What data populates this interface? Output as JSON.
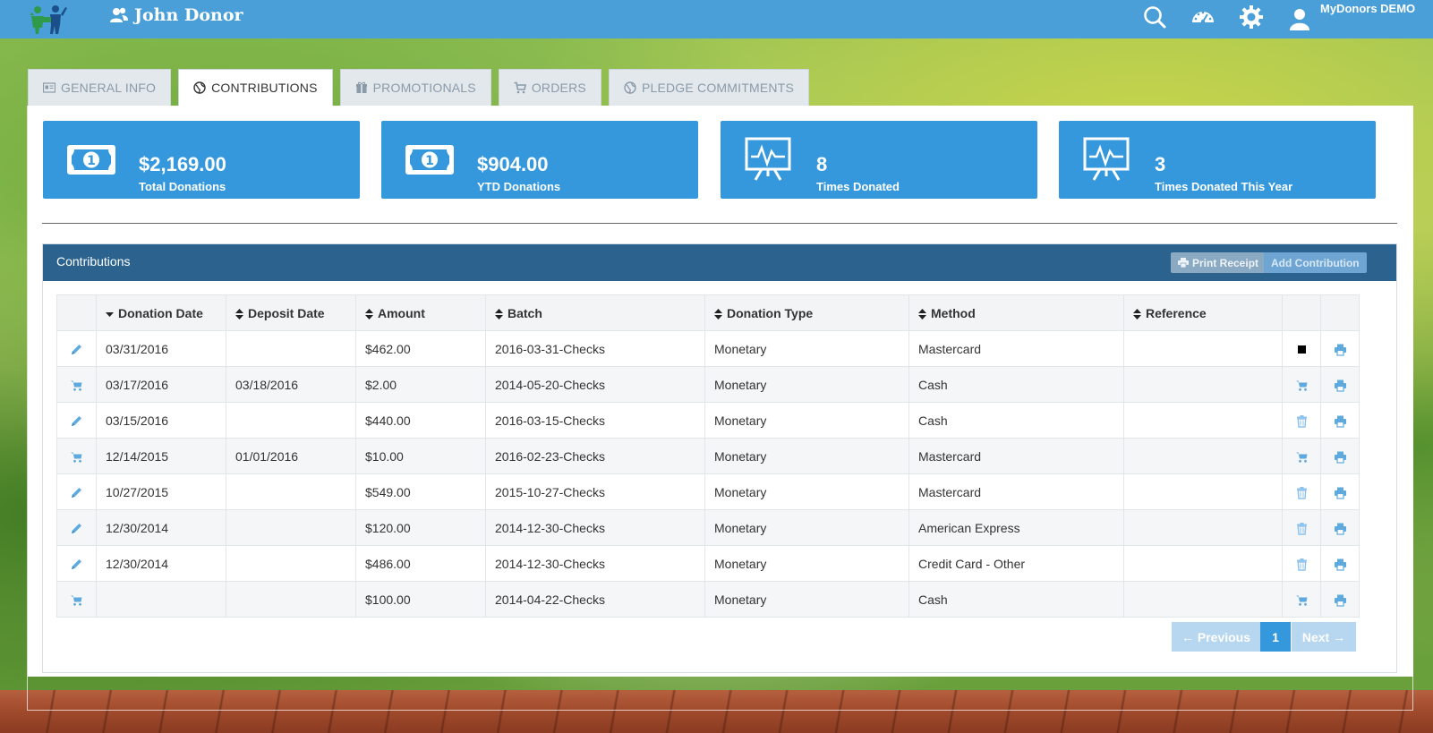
{
  "header": {
    "donor_name": "John Donor",
    "app_name": "MyDonors DEMO",
    "icons": [
      "search-icon",
      "dashboard-icon",
      "gear-icon",
      "user-icon"
    ]
  },
  "tabs": [
    {
      "label": "GENERAL INFO",
      "icon": "id-card-icon"
    },
    {
      "label": "CONTRIBUTIONS",
      "icon": "globe-icon",
      "active": true
    },
    {
      "label": "PROMOTIONALS",
      "icon": "gift-icon"
    },
    {
      "label": "ORDERS",
      "icon": "cart-icon"
    },
    {
      "label": "PLEDGE COMMITMENTS",
      "icon": "globe-icon"
    }
  ],
  "stats": [
    {
      "value": "$2,169.00",
      "label": "Total Donations",
      "icon": "money-icon"
    },
    {
      "value": "$904.00",
      "label": "YTD Donations",
      "icon": "money-icon"
    },
    {
      "value": "8",
      "label": "Times Donated",
      "icon": "chart-board-icon"
    },
    {
      "value": "3",
      "label": "Times Donated This Year",
      "icon": "chart-board-icon"
    }
  ],
  "contributions": {
    "title": "Contributions",
    "print_label": "Print Receipt",
    "add_label": "Add Contribution",
    "columns": [
      "Donation Date",
      "Deposit Date",
      "Amount",
      "Batch",
      "Donation Type",
      "Method",
      "Reference"
    ],
    "rows": [
      {
        "lead": "edit",
        "date": "03/31/2016",
        "deposit": "",
        "amount": "$462.00",
        "batch": "2016-03-31-Checks",
        "type": "Monetary",
        "method": "Mastercard",
        "reference": "",
        "action": "square"
      },
      {
        "lead": "cart",
        "date": "03/17/2016",
        "deposit": "03/18/2016",
        "amount": "$2.00",
        "batch": "2014-05-20-Checks",
        "type": "Monetary",
        "method": "Cash",
        "reference": "",
        "action": "cart"
      },
      {
        "lead": "edit",
        "date": "03/15/2016",
        "deposit": "",
        "amount": "$440.00",
        "batch": "2016-03-15-Checks",
        "type": "Monetary",
        "method": "Cash",
        "reference": "",
        "action": "trash"
      },
      {
        "lead": "cart",
        "date": "12/14/2015",
        "deposit": "01/01/2016",
        "amount": "$10.00",
        "batch": "2016-02-23-Checks",
        "type": "Monetary",
        "method": "Mastercard",
        "reference": "",
        "action": "cart"
      },
      {
        "lead": "edit",
        "date": "10/27/2015",
        "deposit": "",
        "amount": "$549.00",
        "batch": "2015-10-27-Checks",
        "type": "Monetary",
        "method": "Mastercard",
        "reference": "",
        "action": "trash"
      },
      {
        "lead": "edit",
        "date": "12/30/2014",
        "deposit": "",
        "amount": "$120.00",
        "batch": "2014-12-30-Checks",
        "type": "Monetary",
        "method": "American Express",
        "reference": "",
        "action": "trash"
      },
      {
        "lead": "edit",
        "date": "12/30/2014",
        "deposit": "",
        "amount": "$486.00",
        "batch": "2014-12-30-Checks",
        "type": "Monetary",
        "method": "Credit Card - Other",
        "reference": "",
        "action": "trash"
      },
      {
        "lead": "cart",
        "date": "",
        "deposit": "",
        "amount": "$100.00",
        "batch": "2014-04-22-Checks",
        "type": "Monetary",
        "method": "Cash",
        "reference": "",
        "action": "cart"
      }
    ]
  },
  "pagination": {
    "prev_label": "← Previous",
    "current": "1",
    "next_label": "Next →"
  },
  "colors": {
    "topbar": "#4a9fd8",
    "card": "#3598dc",
    "panel_header": "#2b628e",
    "icon_blue": "#5ea9de"
  }
}
